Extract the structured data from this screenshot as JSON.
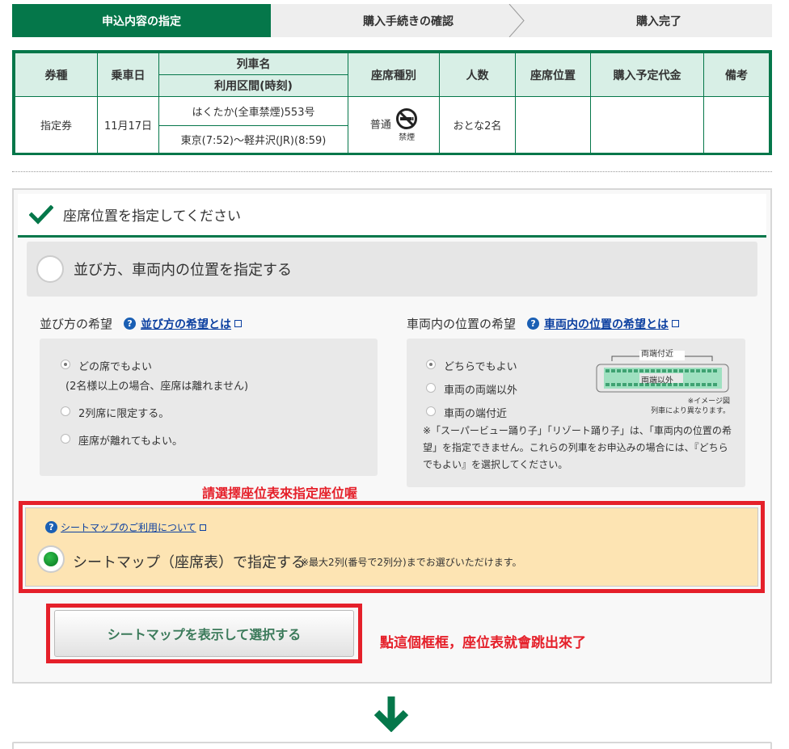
{
  "steps": [
    "申込内容の指定",
    "購入手続きの確認",
    "購入完了"
  ],
  "summary": {
    "headers": {
      "ticket_type": "券種",
      "date": "乗車日",
      "train_name": "列車名",
      "route_time": "利用区間(時刻)",
      "seat_type": "座席種別",
      "count": "人数",
      "seat_position": "座席位置",
      "price": "購入予定代金",
      "remarks": "備考"
    },
    "row": {
      "ticket_type": "指定券",
      "date": "11月17日",
      "train_name": "はくたか(全車禁煙)553号",
      "route_time": "東京(7:52)～軽井沢(JR)(8:59)",
      "seat_type": "普通",
      "no_smoking_label": "禁煙",
      "count": "おとな2名",
      "seat_position": "",
      "price": "",
      "remarks": ""
    }
  },
  "panel": {
    "title": "座席位置を指定してください",
    "option_a_label": "並び方、車両内の位置を指定する",
    "arrangement": {
      "title": "並び方の希望",
      "help_link": "並び方の希望とは",
      "options": [
        "どの席でもよい",
        "(2名様以上の場合、座席は離れません)",
        "2列席に限定する。",
        "座席が離れてもよい。"
      ]
    },
    "position": {
      "title": "車両内の位置の希望",
      "help_link": "車両内の位置の希望とは",
      "options": [
        "どちらでもよい",
        "車両の両端以外",
        "車両の端付近"
      ],
      "image_label_top": "両端付近",
      "image_label_mid": "両端以外",
      "image_note1": "※イメージ図",
      "image_note2": "列車により異なります。",
      "note": "※「スーパービュー踊り子」「リゾート踊り子」は、「車両内の位置の希望」を指定できません。これらの列車をお申込みの場合には、『どちらでもよい』を選択してください。"
    },
    "seatmap": {
      "help_link": "シートマップのご利用について",
      "option_label": "シートマップ（座席表）で指定する",
      "note": "※最大2列(番号で2列分)までお選びいただけます。",
      "button": "シートマップを表示して選択する"
    }
  },
  "annotations": {
    "top": "請選擇座位表來指定座位喔",
    "right": "點這個框框，座位表就會跳出來了"
  },
  "colors": {
    "brand_green": "#05774a",
    "annotation_red": "#e5202a",
    "highlight_bg": "#fde4b3"
  }
}
